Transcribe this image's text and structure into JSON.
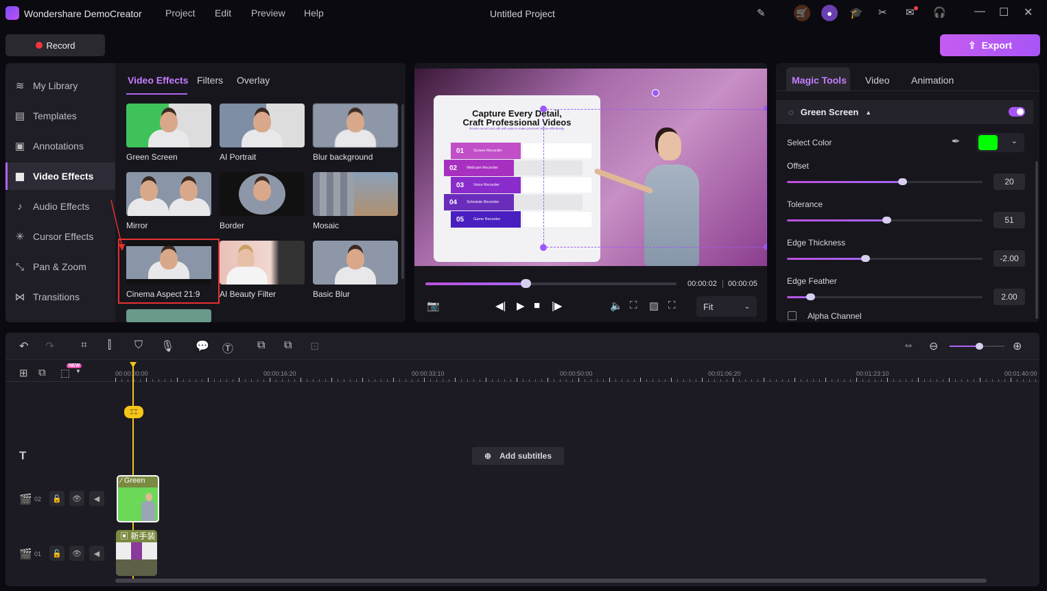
{
  "app": {
    "title": "Wondershare DemoCreator",
    "project_title": "Untitled Project",
    "menu": [
      "Project",
      "Edit",
      "Preview",
      "Help"
    ]
  },
  "toolbar": {
    "record_label": "Record",
    "export_label": "Export"
  },
  "colors": {
    "accent": "#b265f5",
    "record": "#f0353a",
    "key_color": "#00ff00",
    "playhead": "#f5c518"
  },
  "sidebar": {
    "items": [
      {
        "label": "My Library",
        "icon": "layers-icon"
      },
      {
        "label": "Templates",
        "icon": "template-icon"
      },
      {
        "label": "Annotations",
        "icon": "annotation-icon"
      },
      {
        "label": "Video Effects",
        "icon": "video-effects-icon",
        "active": true
      },
      {
        "label": "Audio Effects",
        "icon": "audio-effects-icon"
      },
      {
        "label": "Cursor Effects",
        "icon": "cursor-effects-icon"
      },
      {
        "label": "Pan & Zoom",
        "icon": "pan-zoom-icon"
      },
      {
        "label": "Transitions",
        "icon": "transitions-icon"
      }
    ]
  },
  "effects": {
    "tabs": [
      "Video Effects",
      "Filters",
      "Overlay"
    ],
    "active_tab": "Video Effects",
    "items": [
      "Green Screen",
      "AI Portrait",
      "Blur background",
      "Mirror",
      "Border",
      "Mosaic",
      "Cinema Aspect 21:9",
      "AI Beauty Filter",
      "Basic Blur"
    ],
    "selected": "Cinema Aspect 21:9"
  },
  "slide": {
    "title_line1": "Capture Every Detail,",
    "title_line2": "Craft Professional Videos",
    "subtitle": "Screen record and edit with ease to make pro-level videos effortlessly.",
    "rows": [
      {
        "num": "01",
        "label": "Screen Recorder"
      },
      {
        "num": "02",
        "label": "Webcam Recorder"
      },
      {
        "num": "03",
        "label": "Voice Recorder"
      },
      {
        "num": "04",
        "label": "Schedule Recorder"
      },
      {
        "num": "05",
        "label": "Game Recorder"
      }
    ]
  },
  "player": {
    "current_time": "00:00:02",
    "total_time": "00:00:05",
    "progress": 0.4,
    "zoom_option": "Fit"
  },
  "magic": {
    "tabs": [
      "Magic Tools",
      "Video",
      "Animation"
    ],
    "active_tab": "Magic Tools",
    "section": "Green Screen",
    "enabled": true,
    "select_color_label": "Select Color",
    "sliders": [
      {
        "label": "Offset",
        "value": "20",
        "level": 0.59
      },
      {
        "label": "Tolerance",
        "value": "51",
        "level": 0.51
      },
      {
        "label": "Edge Thickness",
        "value": "-2.00",
        "level": 0.4
      },
      {
        "label": "Edge Feather",
        "value": "2.00",
        "level": 0.12
      }
    ],
    "alpha_channel_label": "Alpha Channel",
    "alpha_channel": false
  },
  "timeline": {
    "ruler": [
      "00:00:00:00",
      "00:00:16:20",
      "00:00:33:10",
      "00:00:50:00",
      "00:01:06:20",
      "00:01:23:10",
      "00:01:40:00"
    ],
    "new_badge": "NEW",
    "add_subtitles": "Add subtitles",
    "tracks": [
      {
        "id": "02",
        "clip": "Green"
      },
      {
        "id": "01",
        "clip": "新手装"
      }
    ]
  }
}
